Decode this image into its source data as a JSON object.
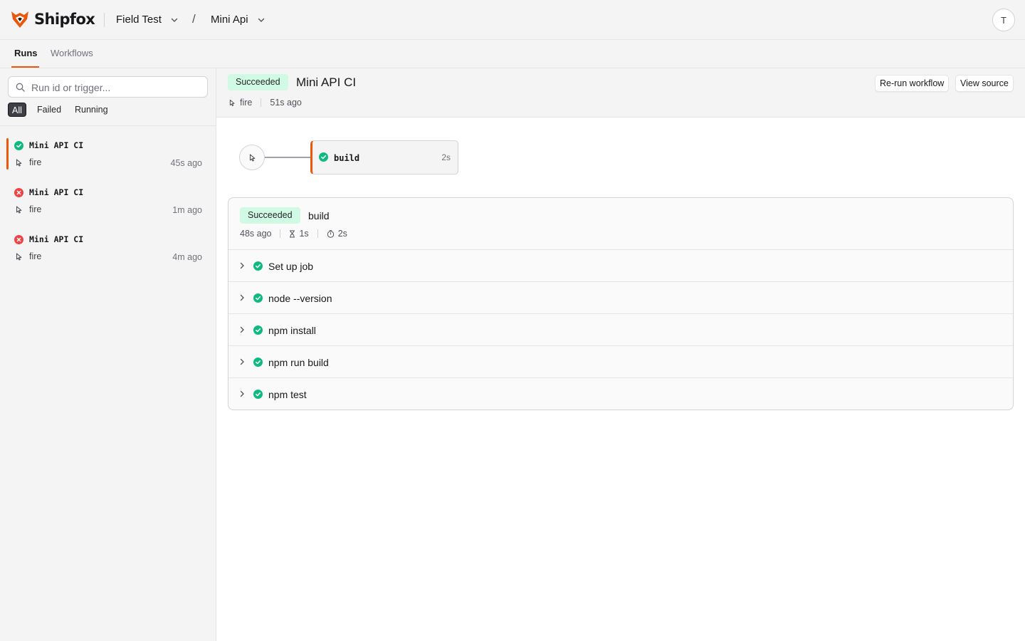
{
  "app": {
    "brand": "Shipfox",
    "accent": "#ea580c",
    "success_color": "#10b981",
    "failure_color": "#ef4444"
  },
  "breadcrumb": {
    "org": "Field Test",
    "separator": "/",
    "project": "Mini Api"
  },
  "user": {
    "initial": "T"
  },
  "tabs": [
    {
      "label": "Runs"
    },
    {
      "label": "Workflows"
    }
  ],
  "sidebar": {
    "search_placeholder": "Run id or trigger...",
    "filters": [
      {
        "label": "All"
      },
      {
        "label": "Failed"
      },
      {
        "label": "Running"
      }
    ],
    "runs": [
      {
        "title": "Mini API CI",
        "status": "success",
        "trigger": "fire",
        "time": "45s ago"
      },
      {
        "title": "Mini API CI",
        "status": "failed",
        "trigger": "fire",
        "time": "1m ago"
      },
      {
        "title": "Mini API CI",
        "status": "failed",
        "trigger": "fire",
        "time": "4m ago"
      }
    ]
  },
  "run": {
    "status": "Succeeded",
    "title": "Mini API CI",
    "trigger": "fire",
    "time": "51s ago",
    "rerun_label": "Re-run workflow",
    "view_source_label": "View source"
  },
  "graph": {
    "job_name": "build",
    "job_duration": "2s"
  },
  "job": {
    "status": "Succeeded",
    "name": "build",
    "started": "48s ago",
    "queued": "1s",
    "duration": "2s",
    "steps": [
      {
        "label": "Set up job"
      },
      {
        "label": "node --version"
      },
      {
        "label": "npm install"
      },
      {
        "label": "npm run build"
      },
      {
        "label": "npm test"
      }
    ]
  }
}
